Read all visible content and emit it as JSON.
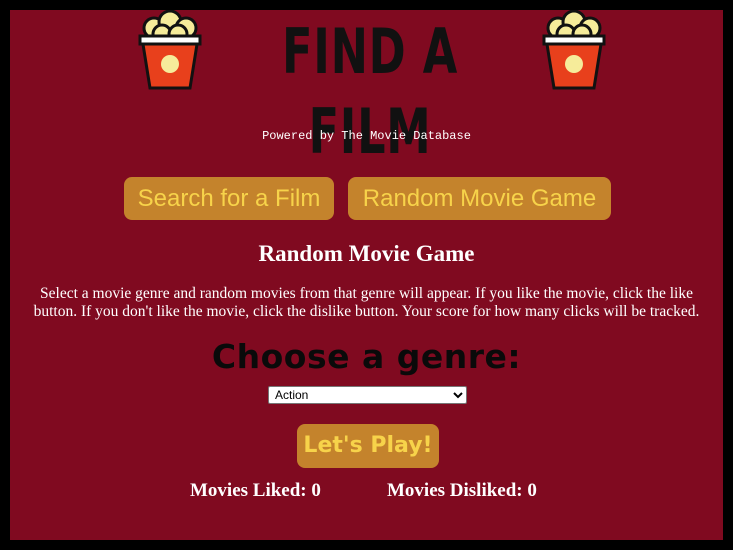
{
  "header": {
    "logo_text": "FIND A FILM",
    "left_icon": "popcorn-icon",
    "right_icon": "popcorn-icon"
  },
  "powered_by": "Powered by The Movie Database",
  "nav": {
    "search_label": "Search for a Film",
    "random_label": "Random Movie Game"
  },
  "game": {
    "title": "Random Movie Game",
    "description": "Select a movie genre and random movies from that genre will appear. If you like the movie, click the like button. If you don't like the movie, click the dislike button. Your score for how many clicks will be tracked.",
    "genre_heading": "Choose a genre:",
    "genre_selected": "Action",
    "play_label": "Let's Play!",
    "liked_label": "Movies Liked:",
    "liked_count": "0",
    "disliked_label": "Movies Disliked:",
    "disliked_count": "0"
  },
  "colors": {
    "background": "#800a20",
    "button": "#c4832c",
    "button_text": "#f7d34a",
    "popcorn_bucket": "#e8401c"
  }
}
